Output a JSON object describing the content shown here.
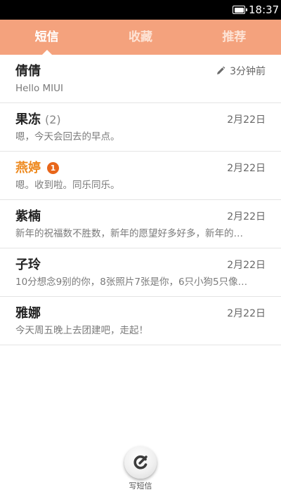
{
  "status_bar": {
    "time": "18:37",
    "battery_icon": "battery-full-icon"
  },
  "tabs": [
    {
      "label": "短信",
      "active": true
    },
    {
      "label": "收藏",
      "active": false
    },
    {
      "label": "推荐",
      "active": false
    }
  ],
  "messages": [
    {
      "name": "倩倩",
      "count": "",
      "unread": "",
      "time": "3分钟前",
      "draft": true,
      "preview": "Hello MIUI",
      "highlight": false
    },
    {
      "name": "果冻",
      "count": "(2)",
      "unread": "",
      "time": "2月22日",
      "draft": false,
      "preview": "嗯，今天会回去的早点。",
      "highlight": false
    },
    {
      "name": "燕婷",
      "count": "",
      "unread": "1",
      "time": "2月22日",
      "draft": false,
      "preview": "嗯。收到啦。同乐同乐。",
      "highlight": true
    },
    {
      "name": "紫楠",
      "count": "",
      "unread": "",
      "time": "2月22日",
      "draft": false,
      "preview": "新年的祝福数不胜数，新年的愿望好多好多，新年的…",
      "highlight": false
    },
    {
      "name": "子玲",
      "count": "",
      "unread": "",
      "time": "2月22日",
      "draft": false,
      "preview": "10分想念9别的你，8张照片7张是你，6只小狗5只像…",
      "highlight": false
    },
    {
      "name": "雅娜",
      "count": "",
      "unread": "",
      "time": "2月22日",
      "draft": false,
      "preview": "今天周五晚上去团建吧，走起！",
      "highlight": false
    }
  ],
  "compose": {
    "label": "写短信",
    "icon": "compose-icon"
  },
  "colors": {
    "accent": "#f4a27d",
    "highlight_name": "#ee8a1f",
    "badge": "#e8661a"
  }
}
